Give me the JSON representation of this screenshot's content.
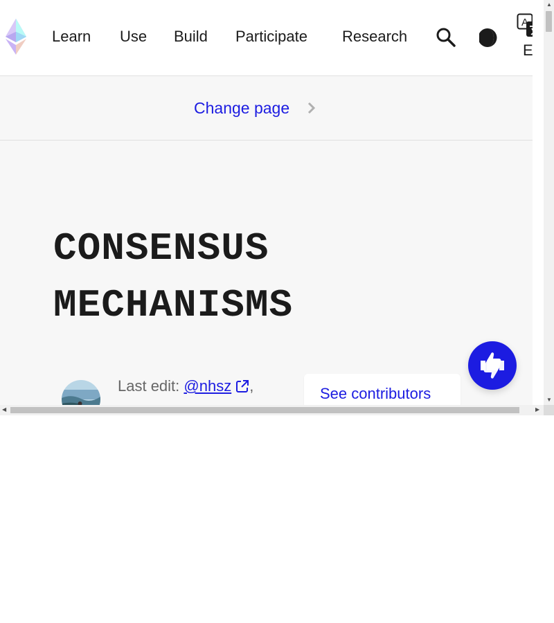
{
  "nav": {
    "items": [
      {
        "label": "Learn"
      },
      {
        "label": "Use"
      },
      {
        "label": "Build"
      },
      {
        "label": "Participate"
      },
      {
        "label": "Research"
      }
    ],
    "language": "EN",
    "icons": {
      "search": "search-icon",
      "theme": "dark-mode-icon",
      "translate": "translate-icon",
      "logo": "ethereum-logo"
    }
  },
  "change_page": {
    "label": "Change page"
  },
  "page": {
    "title_line1": "CONSENSUS",
    "title_line2": "MECHANISMS"
  },
  "meta": {
    "last_edit_prefix": "Last edit:",
    "author": "@nhsz",
    "after_author": ",",
    "contributors_button": "See contributors"
  },
  "colors": {
    "accent": "#1c1ce1",
    "text": "#1b1b1b",
    "muted": "#666666",
    "background": "#f7f7f7"
  }
}
